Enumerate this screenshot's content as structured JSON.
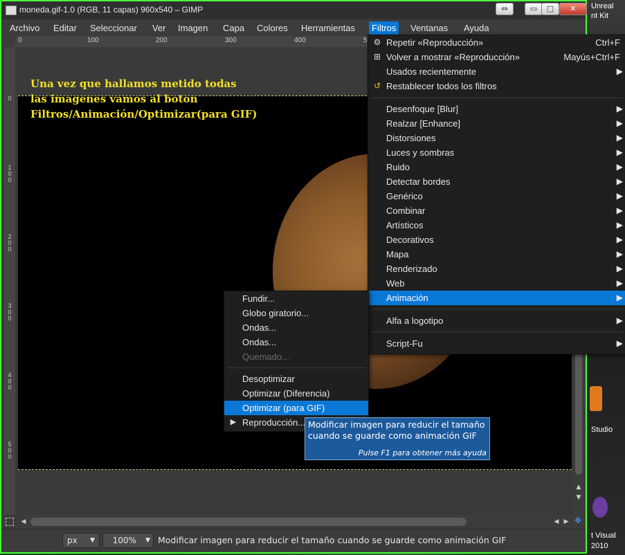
{
  "window": {
    "title": "moneda.gif-1.0 (RGB, 11 capas) 960x540 – GIMP"
  },
  "titlebar_buttons": {
    "restore": "⇔",
    "minimize": "▭",
    "maximize": "□",
    "close": "✕"
  },
  "desktop": {
    "top_right_1": "Unreal",
    "top_right_2": "nt Kit",
    "side_1": "Studio",
    "bottom_1": "t Visual",
    "bottom_2": "2010"
  },
  "menubar": [
    "Archivo",
    "Editar",
    "Seleccionar",
    "Ver",
    "Imagen",
    "Capa",
    "Colores",
    "Herramientas",
    "Filtros",
    "Ventanas",
    "Ayuda"
  ],
  "ruler_top": [
    "0",
    "100",
    "200",
    "300",
    "400",
    "5"
  ],
  "ruler_left": [
    "0",
    "1 0 0",
    "2 0 0",
    "3 0 0",
    "4 0 0",
    "5 0 0"
  ],
  "overlay_text": {
    "line1": "Una vez que hallamos metido todas",
    "line2": "las imagenes vamos al boton",
    "line3": "Filtros/Animación/Optimizar(para GIF)"
  },
  "filtros_menu": {
    "items": [
      {
        "label": "Repetir «Reproducción»",
        "accel": "Ctrl+F",
        "icon": "gear-icon"
      },
      {
        "label": "Volver a mostrar «Reproducción»",
        "accel": "Mayús+Ctrl+F",
        "icon": "reshow-icon"
      },
      {
        "label": "Usados recientemente",
        "submenu": true
      },
      {
        "label": "Restablecer todos los filtros",
        "icon": "reset-icon"
      },
      {
        "label": "Desenfoque [Blur]",
        "submenu": true
      },
      {
        "label": "Realzar [Enhance]",
        "submenu": true
      },
      {
        "label": "Distorsiones",
        "submenu": true
      },
      {
        "label": "Luces y sombras",
        "submenu": true
      },
      {
        "label": "Ruido",
        "submenu": true
      },
      {
        "label": "Detectar bordes",
        "submenu": true
      },
      {
        "label": "Genérico",
        "submenu": true
      },
      {
        "label": "Combinar",
        "submenu": true
      },
      {
        "label": "Artísticos",
        "submenu": true
      },
      {
        "label": "Decorativos",
        "submenu": true
      },
      {
        "label": "Mapa",
        "submenu": true
      },
      {
        "label": "Renderizado",
        "submenu": true
      },
      {
        "label": "Web",
        "submenu": true
      },
      {
        "label": "Animación",
        "submenu": true
      },
      {
        "label": "Alfa a logotipo",
        "submenu": true
      },
      {
        "label": "Script-Fu",
        "submenu": true
      }
    ]
  },
  "animacion_menu": {
    "items": [
      {
        "label": "Fundir..."
      },
      {
        "label": "Globo giratorio..."
      },
      {
        "label": "Ondas..."
      },
      {
        "label": "Ondas..."
      },
      {
        "label": "Quemado...",
        "disabled": true
      },
      {
        "label": "Desoptimizar"
      },
      {
        "label": "Optimizar (Diferencia)"
      },
      {
        "label": "Optimizar (para GIF)"
      },
      {
        "label": "Reproducción..."
      }
    ]
  },
  "tooltip": {
    "line1": "Modificar imagen para reducir el tamaño",
    "line2": "cuando se guarde como animación GIF",
    "hint": "Pulse F1 para obtener más ayuda"
  },
  "statusbar": {
    "unit": "px",
    "zoom": "100%",
    "message": "Modificar imagen para reducir el tamaño cuando se guarde como animación GIF"
  }
}
